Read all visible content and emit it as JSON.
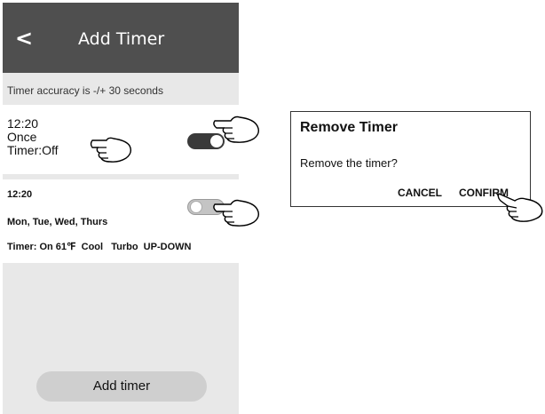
{
  "header": {
    "back_glyph": "<",
    "title": "Add Timer"
  },
  "accuracy_note": "Timer accuracy is -/+ 30 seconds",
  "timers": [
    {
      "time": "12:20",
      "repeat": "Once",
      "status": "Timer:Off",
      "enabled": true
    },
    {
      "time": "12:20",
      "repeat": "Mon, Tue, Wed, Thurs",
      "status": "Timer: On 61℉  Cool   Turbo  UP-DOWN",
      "enabled": false
    }
  ],
  "add_button_label": "Add timer",
  "dialog": {
    "title": "Remove Timer",
    "message": "Remove the timer?",
    "cancel_label": "CANCEL",
    "confirm_label": "CONFIRM"
  },
  "icons": {
    "back": "back-arrow-icon",
    "pointer": "pointing-hand-icon"
  },
  "colors": {
    "header_bg": "#4f4f4f",
    "panel_bg": "#e8e8e8",
    "toggle_on": "#3a3a3a",
    "toggle_off": "#c4c4c4"
  }
}
